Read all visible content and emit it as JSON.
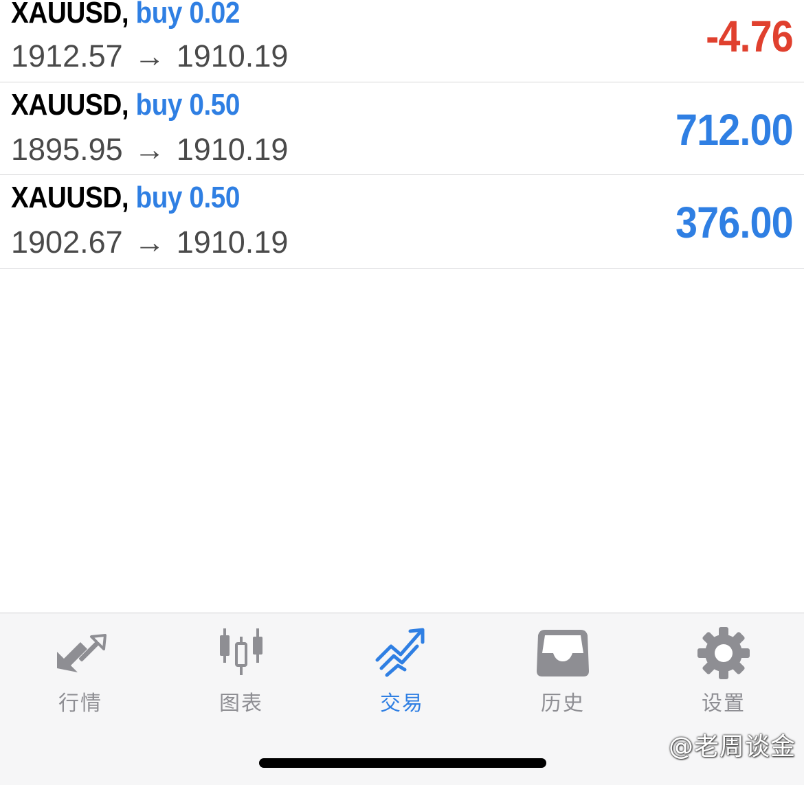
{
  "positions": [
    {
      "symbol": "XAUUSD,",
      "side": "buy 0.02",
      "open_price": "1912.57",
      "arrow": "→",
      "current_price": "1910.19",
      "profit": "-4.76",
      "profit_color": "#e0402e"
    },
    {
      "symbol": "XAUUSD,",
      "side": "buy 0.50",
      "open_price": "1895.95",
      "arrow": "→",
      "current_price": "1910.19",
      "profit": "712.00",
      "profit_color": "#2f7fe3"
    },
    {
      "symbol": "XAUUSD,",
      "side": "buy 0.50",
      "open_price": "1902.67",
      "arrow": "→",
      "current_price": "1910.19",
      "profit": "376.00",
      "profit_color": "#2f7fe3"
    }
  ],
  "tabs": [
    {
      "label": "行情",
      "icon": "quotes-arrows-icon",
      "active": false
    },
    {
      "label": "图表",
      "icon": "candlestick-chart-icon",
      "active": false
    },
    {
      "label": "交易",
      "icon": "trade-trend-icon",
      "active": true
    },
    {
      "label": "历史",
      "icon": "history-inbox-icon",
      "active": false
    },
    {
      "label": "设置",
      "icon": "gear-icon",
      "active": false
    }
  ],
  "watermark": "@老周谈金",
  "colors": {
    "accent": "#2f7fe3",
    "loss": "#e0402e",
    "inactive_icon": "#8e8e93"
  }
}
